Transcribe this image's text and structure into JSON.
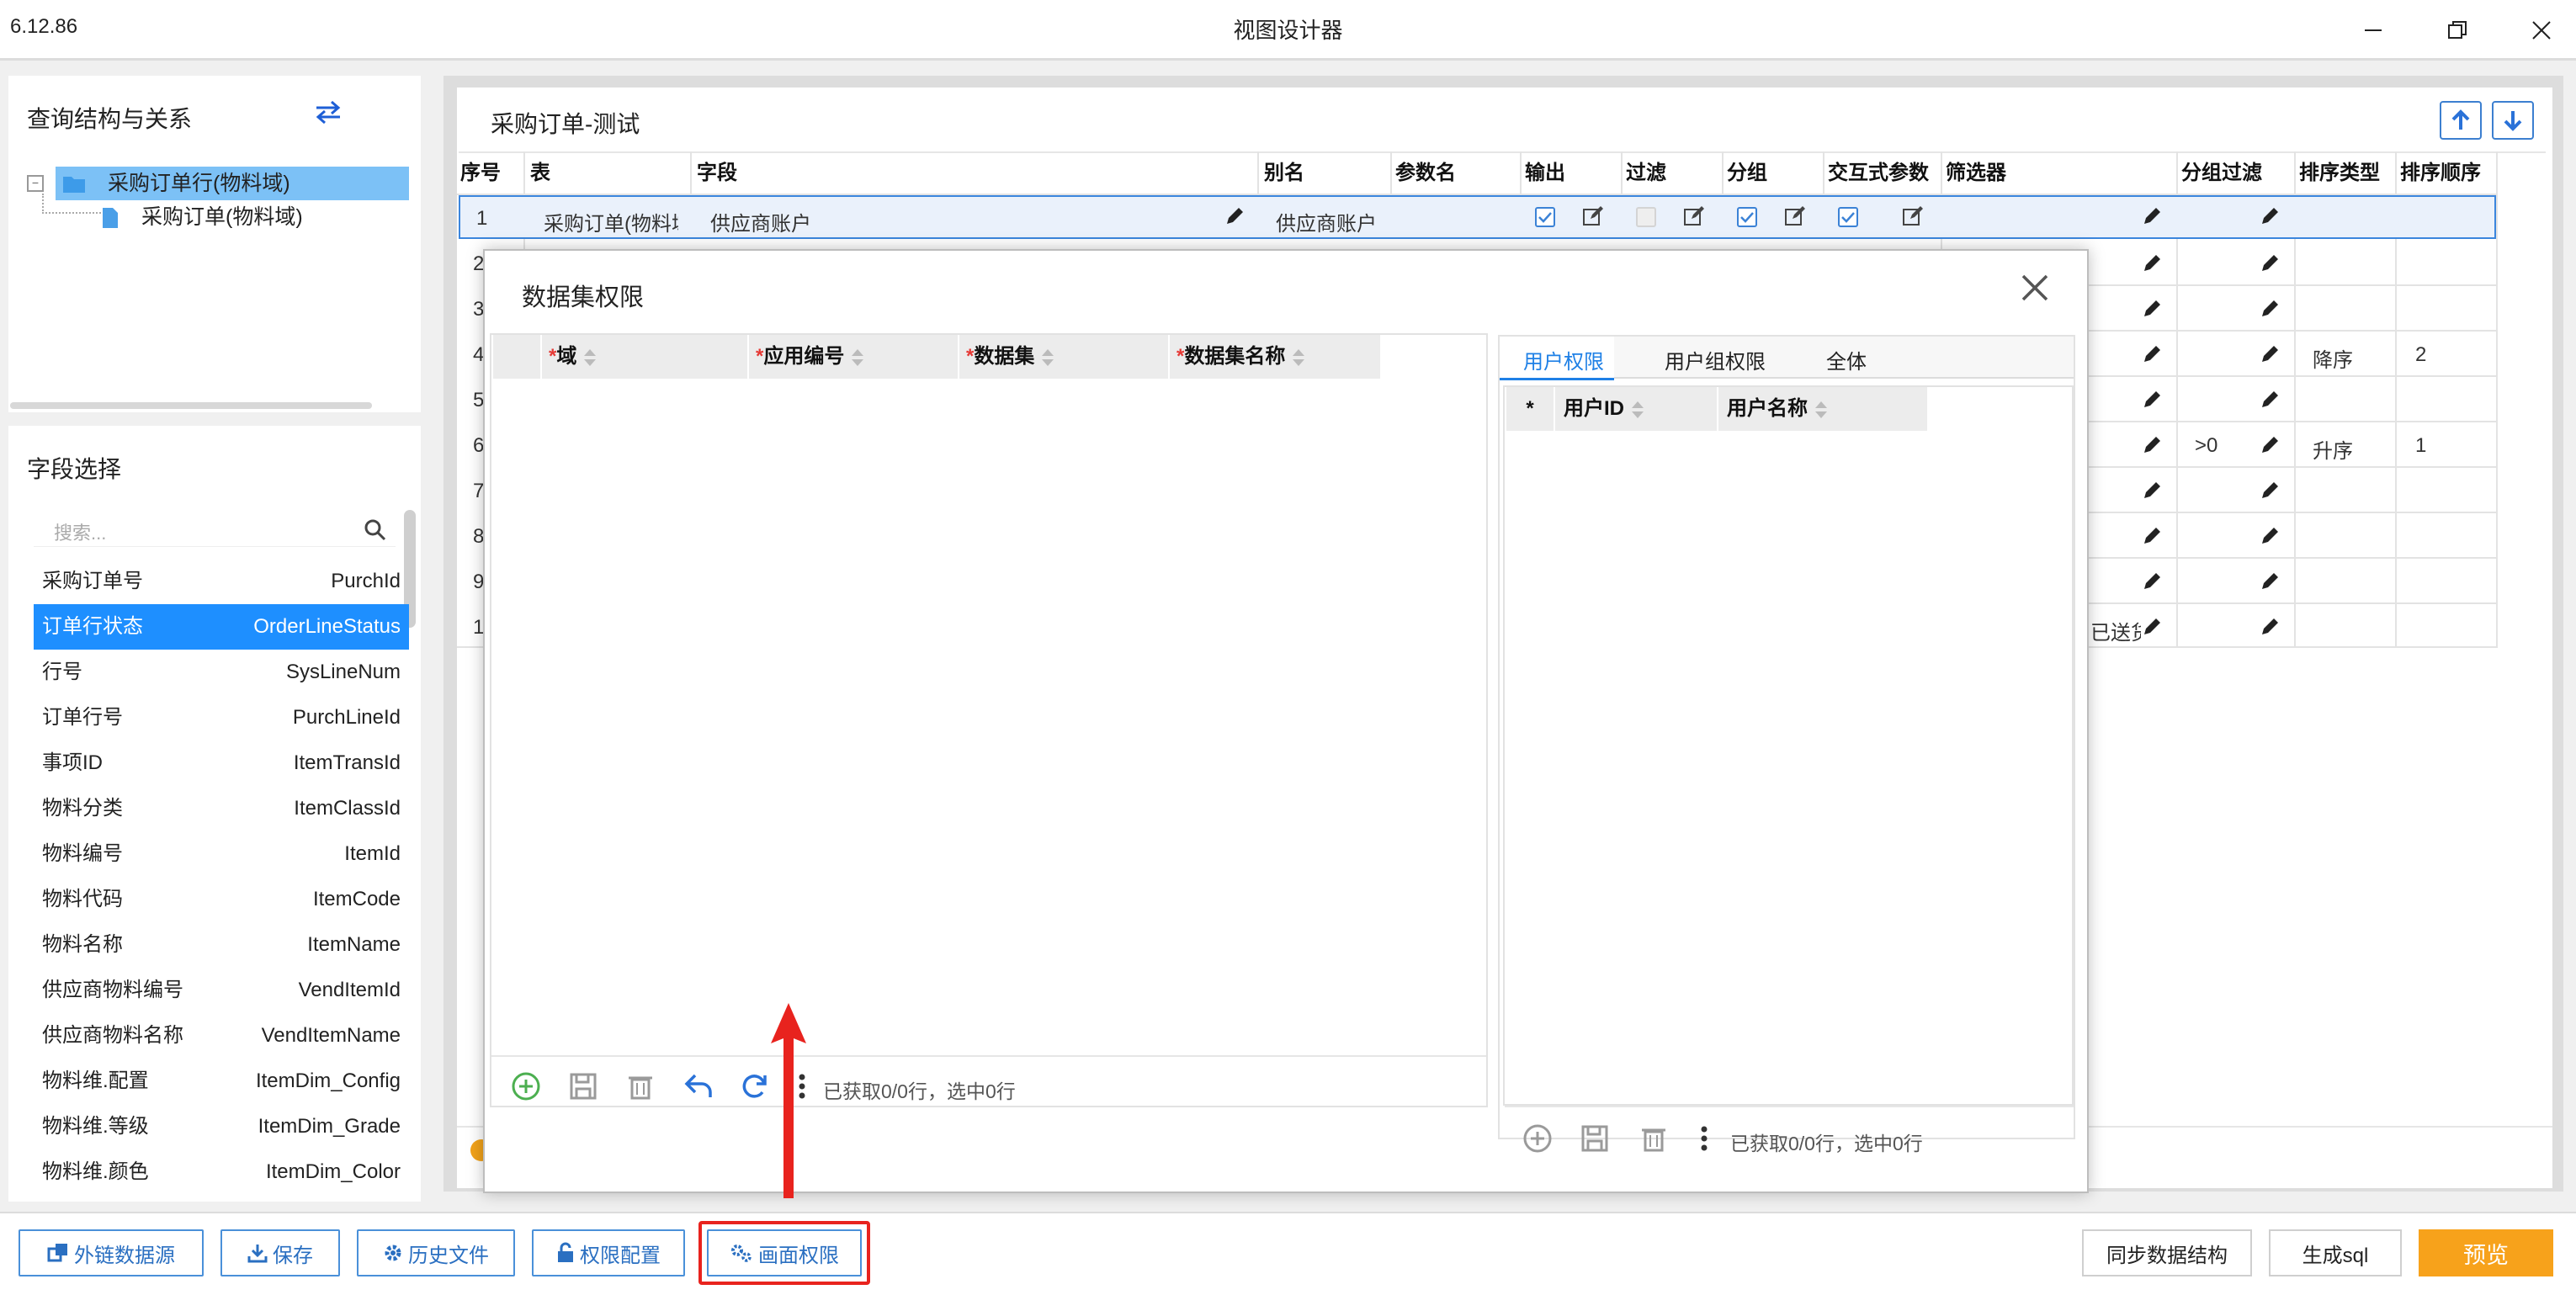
{
  "window": {
    "version": "6.12.86",
    "title": "视图设计器"
  },
  "left_top": {
    "title": "查询结构与关系",
    "tree": [
      {
        "label": "采购订单行(物料域)",
        "selected": true
      },
      {
        "label": "采购订单(物料域)",
        "selected": false
      }
    ]
  },
  "left_bottom": {
    "title": "字段选择",
    "search_placeholder": "搜索...",
    "fields": [
      {
        "cn": "采购订单号",
        "en": "PurchId"
      },
      {
        "cn": "订单行状态",
        "en": "OrderLineStatus"
      },
      {
        "cn": "行号",
        "en": "SysLineNum"
      },
      {
        "cn": "订单行号",
        "en": "PurchLineId"
      },
      {
        "cn": "事项ID",
        "en": "ItemTransId"
      },
      {
        "cn": "物料分类",
        "en": "ItemClassId"
      },
      {
        "cn": "物料编号",
        "en": "ItemId"
      },
      {
        "cn": "物料代码",
        "en": "ItemCode"
      },
      {
        "cn": "物料名称",
        "en": "ItemName"
      },
      {
        "cn": "供应商物料编号",
        "en": "VendItemId"
      },
      {
        "cn": "供应商物料名称",
        "en": "VendItemName"
      },
      {
        "cn": "物料维.配置",
        "en": "ItemDim_Config"
      },
      {
        "cn": "物料维.等级",
        "en": "ItemDim_Grade"
      },
      {
        "cn": "物料维.颜色",
        "en": "ItemDim_Color"
      }
    ]
  },
  "main": {
    "title": "采购订单-测试",
    "columns": [
      "序号",
      "表",
      "字段",
      "别名",
      "参数名",
      "输出",
      "过滤",
      "分组",
      "交互式参数",
      "筛选器",
      "分组过滤",
      "排序类型",
      "排序顺序"
    ],
    "row1": {
      "seq": "1",
      "table": "采购订单(物料域)",
      "field": "供应商账户",
      "alias": "供应商账户"
    },
    "row_seq_partial": [
      "2",
      "3",
      "4",
      "5",
      "6",
      "7",
      "8",
      "9",
      "1"
    ],
    "filter_partial_r10": "已送货",
    "group_filter_r6": ">0",
    "sort_type": {
      "r4": "降序",
      "r6": "升序"
    },
    "sort_order": {
      "r4": "2",
      "r6": "1"
    }
  },
  "dialog": {
    "title": "数据集权限",
    "left_columns": [
      "域",
      "应用编号",
      "数据集",
      "数据集名称"
    ],
    "left_status": "已获取0/0行，选中0行",
    "tabs": [
      "用户权限",
      "用户组权限",
      "全体"
    ],
    "right_columns": [
      "*",
      "用户ID",
      "用户名称"
    ],
    "right_status": "已获取0/0行，选中0行"
  },
  "footer": {
    "buttons": [
      "外链数据源",
      "保存",
      "历史文件",
      "权限配置",
      "画面权限"
    ],
    "right_buttons": [
      "同步数据结构",
      "生成sql",
      "预览"
    ]
  },
  "colors": {
    "accent": "#1e8fff",
    "preview": "#f7a21b",
    "arrow": "#e8231e"
  }
}
